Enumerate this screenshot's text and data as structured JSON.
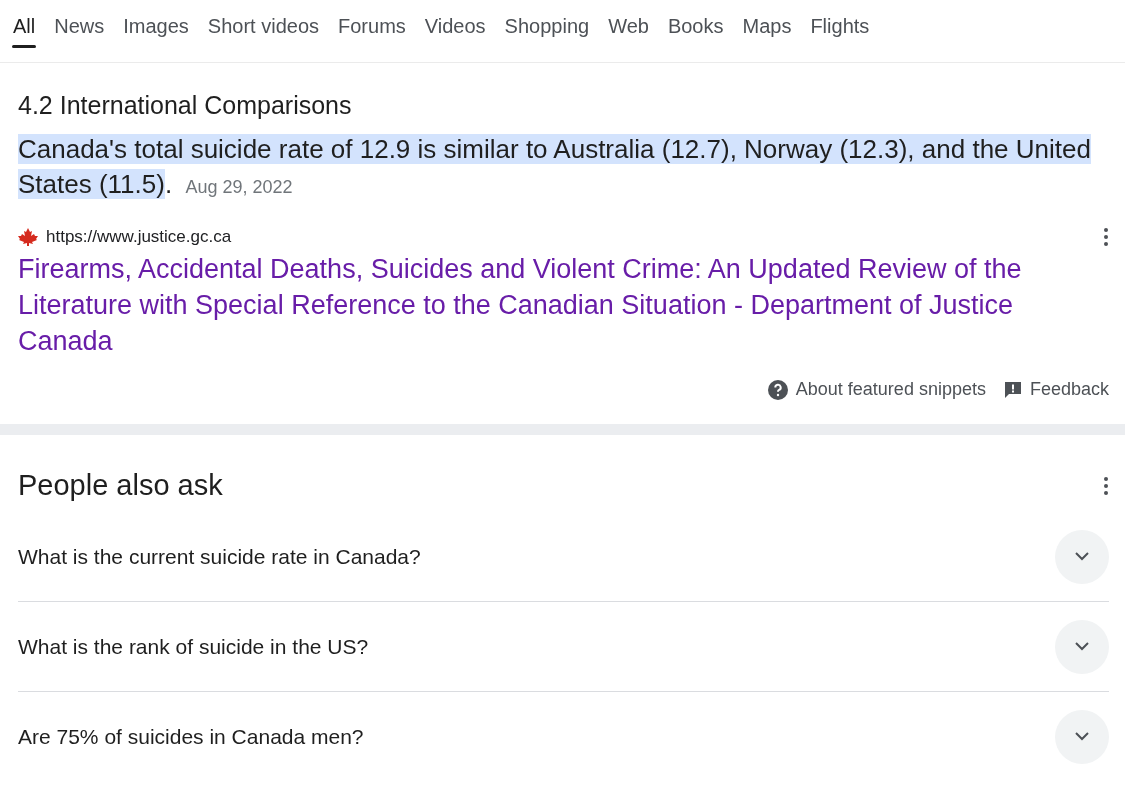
{
  "tabs": [
    {
      "label": "All",
      "selected": true
    },
    {
      "label": "News",
      "selected": false
    },
    {
      "label": "Images",
      "selected": false
    },
    {
      "label": "Short videos",
      "selected": false
    },
    {
      "label": "Forums",
      "selected": false
    },
    {
      "label": "Videos",
      "selected": false
    },
    {
      "label": "Shopping",
      "selected": false
    },
    {
      "label": "Web",
      "selected": false
    },
    {
      "label": "Books",
      "selected": false
    },
    {
      "label": "Maps",
      "selected": false
    },
    {
      "label": "Flights",
      "selected": false
    }
  ],
  "featured_snippet": {
    "heading": "4.2 International Comparisons",
    "highlighted_text": "Canada's total suicide rate of 12.9 is similar to Australia (12.7), Norway (12.3), and the United States (11.5)",
    "trailing_text": ".",
    "date": "Aug 29, 2022",
    "source_url": "https://www.justice.gc.ca",
    "title": "Firearms, Accidental Deaths, Suicides and Violent Crime: An Updated Review of the Literature with Special Reference to the Canadian Situation - Department of Justice Canada",
    "footer_links": [
      "About featured snippets",
      "Feedback"
    ]
  },
  "people_also_ask": {
    "heading": "People also ask",
    "questions": [
      {
        "text": "What is the current suicide rate in Canada?",
        "expanded": false
      },
      {
        "text": "What is the rank of suicide in the US?",
        "expanded": false
      },
      {
        "text": "Are 75% of suicides in Canada men?",
        "expanded": false
      }
    ]
  }
}
